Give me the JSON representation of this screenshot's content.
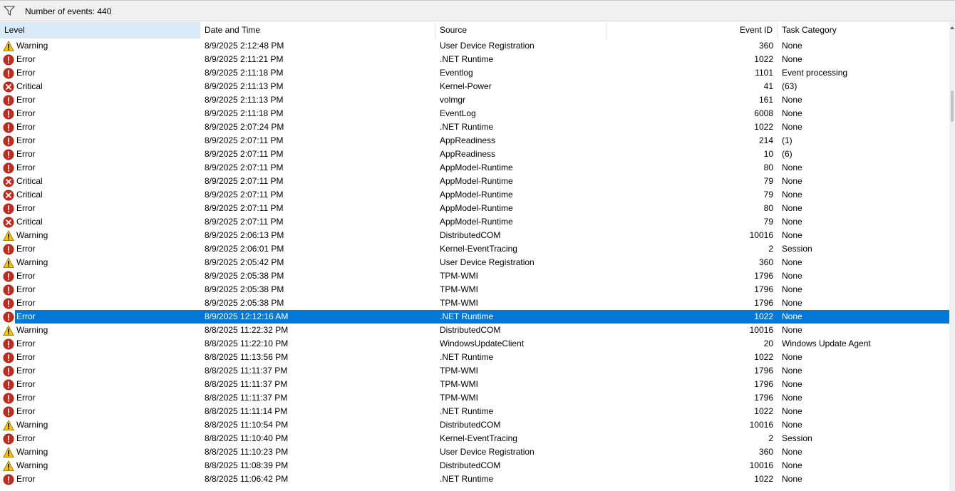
{
  "toolbar": {
    "filter_icon": "filter-funnel-icon",
    "event_count": "Number of events: 440"
  },
  "columns": {
    "level": "Level",
    "date": "Date and Time",
    "source": "Source",
    "event_id": "Event ID",
    "task": "Task Category"
  },
  "colors": {
    "selection": "#0078d7",
    "sorted_header": "#d9ebf9",
    "error": "#c42b1c",
    "warning": "#f5c400"
  },
  "events": [
    {
      "level": "Warning",
      "date": "8/9/2025 2:12:48 PM",
      "source": "User Device Registration",
      "event_id": "360",
      "task": "None"
    },
    {
      "level": "Error",
      "date": "8/9/2025 2:11:21 PM",
      "source": ".NET Runtime",
      "event_id": "1022",
      "task": "None"
    },
    {
      "level": "Error",
      "date": "8/9/2025 2:11:18 PM",
      "source": "Eventlog",
      "event_id": "1101",
      "task": "Event processing"
    },
    {
      "level": "Critical",
      "date": "8/9/2025 2:11:13 PM",
      "source": "Kernel-Power",
      "event_id": "41",
      "task": "(63)"
    },
    {
      "level": "Error",
      "date": "8/9/2025 2:11:13 PM",
      "source": "volmgr",
      "event_id": "161",
      "task": "None"
    },
    {
      "level": "Error",
      "date": "8/9/2025 2:11:18 PM",
      "source": "EventLog",
      "event_id": "6008",
      "task": "None"
    },
    {
      "level": "Error",
      "date": "8/9/2025 2:07:24 PM",
      "source": ".NET Runtime",
      "event_id": "1022",
      "task": "None"
    },
    {
      "level": "Error",
      "date": "8/9/2025 2:07:11 PM",
      "source": "AppReadiness",
      "event_id": "214",
      "task": "(1)"
    },
    {
      "level": "Error",
      "date": "8/9/2025 2:07:11 PM",
      "source": "AppReadiness",
      "event_id": "10",
      "task": "(6)"
    },
    {
      "level": "Error",
      "date": "8/9/2025 2:07:11 PM",
      "source": "AppModel-Runtime",
      "event_id": "80",
      "task": "None"
    },
    {
      "level": "Critical",
      "date": "8/9/2025 2:07:11 PM",
      "source": "AppModel-Runtime",
      "event_id": "79",
      "task": "None"
    },
    {
      "level": "Critical",
      "date": "8/9/2025 2:07:11 PM",
      "source": "AppModel-Runtime",
      "event_id": "79",
      "task": "None"
    },
    {
      "level": "Error",
      "date": "8/9/2025 2:07:11 PM",
      "source": "AppModel-Runtime",
      "event_id": "80",
      "task": "None"
    },
    {
      "level": "Critical",
      "date": "8/9/2025 2:07:11 PM",
      "source": "AppModel-Runtime",
      "event_id": "79",
      "task": "None"
    },
    {
      "level": "Warning",
      "date": "8/9/2025 2:06:13 PM",
      "source": "DistributedCOM",
      "event_id": "10016",
      "task": "None"
    },
    {
      "level": "Error",
      "date": "8/9/2025 2:06:01 PM",
      "source": "Kernel-EventTracing",
      "event_id": "2",
      "task": "Session"
    },
    {
      "level": "Warning",
      "date": "8/9/2025 2:05:42 PM",
      "source": "User Device Registration",
      "event_id": "360",
      "task": "None"
    },
    {
      "level": "Error",
      "date": "8/9/2025 2:05:38 PM",
      "source": "TPM-WMI",
      "event_id": "1796",
      "task": "None"
    },
    {
      "level": "Error",
      "date": "8/9/2025 2:05:38 PM",
      "source": "TPM-WMI",
      "event_id": "1796",
      "task": "None"
    },
    {
      "level": "Error",
      "date": "8/9/2025 2:05:38 PM",
      "source": "TPM-WMI",
      "event_id": "1796",
      "task": "None"
    },
    {
      "level": "Error",
      "date": "8/9/2025 12:12:16 AM",
      "source": ".NET Runtime",
      "event_id": "1022",
      "task": "None",
      "selected": true
    },
    {
      "level": "Warning",
      "date": "8/8/2025 11:22:32 PM",
      "source": "DistributedCOM",
      "event_id": "10016",
      "task": "None"
    },
    {
      "level": "Error",
      "date": "8/8/2025 11:22:10 PM",
      "source": "WindowsUpdateClient",
      "event_id": "20",
      "task": "Windows Update Agent"
    },
    {
      "level": "Error",
      "date": "8/8/2025 11:13:56 PM",
      "source": ".NET Runtime",
      "event_id": "1022",
      "task": "None"
    },
    {
      "level": "Error",
      "date": "8/8/2025 11:11:37 PM",
      "source": "TPM-WMI",
      "event_id": "1796",
      "task": "None"
    },
    {
      "level": "Error",
      "date": "8/8/2025 11:11:37 PM",
      "source": "TPM-WMI",
      "event_id": "1796",
      "task": "None"
    },
    {
      "level": "Error",
      "date": "8/8/2025 11:11:37 PM",
      "source": "TPM-WMI",
      "event_id": "1796",
      "task": "None"
    },
    {
      "level": "Error",
      "date": "8/8/2025 11:11:14 PM",
      "source": ".NET Runtime",
      "event_id": "1022",
      "task": "None"
    },
    {
      "level": "Warning",
      "date": "8/8/2025 11:10:54 PM",
      "source": "DistributedCOM",
      "event_id": "10016",
      "task": "None"
    },
    {
      "level": "Error",
      "date": "8/8/2025 11:10:40 PM",
      "source": "Kernel-EventTracing",
      "event_id": "2",
      "task": "Session"
    },
    {
      "level": "Warning",
      "date": "8/8/2025 11:10:23 PM",
      "source": "User Device Registration",
      "event_id": "360",
      "task": "None"
    },
    {
      "level": "Warning",
      "date": "8/8/2025 11:08:39 PM",
      "source": "DistributedCOM",
      "event_id": "10016",
      "task": "None"
    },
    {
      "level": "Error",
      "date": "8/8/2025 11:06:42 PM",
      "source": ".NET Runtime",
      "event_id": "1022",
      "task": "None"
    }
  ]
}
